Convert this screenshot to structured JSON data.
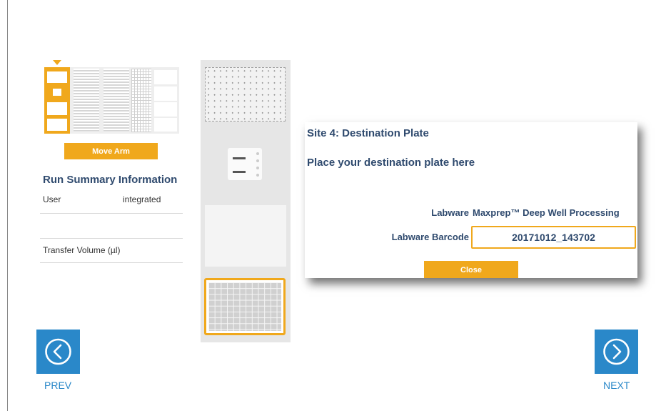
{
  "deck_map": {
    "move_arm_label": "Move Arm"
  },
  "run_summary": {
    "title": "Run Summary Information",
    "rows": [
      {
        "label": "User",
        "value": "integrated"
      },
      {
        "label": "",
        "value": ""
      },
      {
        "label": "Transfer Volume (µl)",
        "value": ""
      }
    ]
  },
  "dialog": {
    "title": "Site 4: Destination Plate",
    "instruction": "Place your destination plate here",
    "labware_label": "Labware",
    "labware_value": "Maxprep™ Deep Well Processing",
    "barcode_label": "Labware Barcode",
    "barcode_value": "20171012_143702",
    "close_label": "Close"
  },
  "navigation": {
    "prev_label": "PREV",
    "next_label": "NEXT",
    "prev_icon": "chevron-left-circle-icon",
    "next_icon": "chevron-right-circle-icon"
  },
  "colors": {
    "accent": "#f0a81c",
    "nav_blue": "#2a88c9",
    "heading_navy": "#2f4a6e"
  }
}
